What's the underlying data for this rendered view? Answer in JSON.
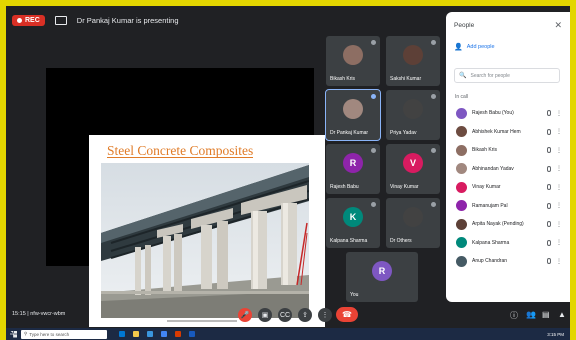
{
  "topbar": {
    "rec_label": "REC",
    "meeting_title": "Dr Pankaj Kumar is presenting"
  },
  "slide": {
    "title": "Steel Concrete Composites"
  },
  "tiles": [
    {
      "name": "Bikash Kris",
      "initial": "",
      "color": "#8d6e63"
    },
    {
      "name": "Sakshi Kumar",
      "initial": "",
      "color": "#5d4037"
    },
    {
      "name": "Dr Pankaj Kumar",
      "initial": "",
      "color": "#a1887f"
    },
    {
      "name": "Priya Yadav",
      "initial": "",
      "color": "#424242"
    },
    {
      "name": "Rajesh Babu",
      "initial": "R",
      "color": "#8e24aa"
    },
    {
      "name": "Vinay Kumar",
      "initial": "V",
      "color": "#d81b60"
    },
    {
      "name": "Kalpana Sharma",
      "initial": "K",
      "color": "#00897b"
    },
    {
      "name": "Dr Others",
      "initial": "",
      "color": "#424242"
    },
    {
      "name": "You",
      "initial": "R",
      "color": "#7e57c2"
    }
  ],
  "panel": {
    "title": "People",
    "add_people": "Add people",
    "search_placeholder": "Search for people",
    "in_call_label": "In call",
    "participants": [
      {
        "name": "Rajesh Babu (You)",
        "color": "#7e57c2"
      },
      {
        "name": "Abhishek Kumar Hem",
        "color": "#6d4c41"
      },
      {
        "name": "Bikash Kris",
        "color": "#8d6e63"
      },
      {
        "name": "Abhinandan Yadav",
        "color": "#a1887f"
      },
      {
        "name": "Vinay Kumar",
        "color": "#d81b60"
      },
      {
        "name": "Ramanujam Pal",
        "color": "#8e24aa"
      },
      {
        "name": "Arpita Nayak (Pending)",
        "color": "#5d4037"
      },
      {
        "name": "Kalpana Sharma",
        "color": "#00897b"
      },
      {
        "name": "Anup Chandran",
        "color": "#455a64"
      }
    ]
  },
  "bottombar": {
    "meeting_time": "15:15 | nfw-vwcr-wbm"
  },
  "taskbar": {
    "search_placeholder": "Type here to search",
    "clock": "3:15 PM"
  }
}
